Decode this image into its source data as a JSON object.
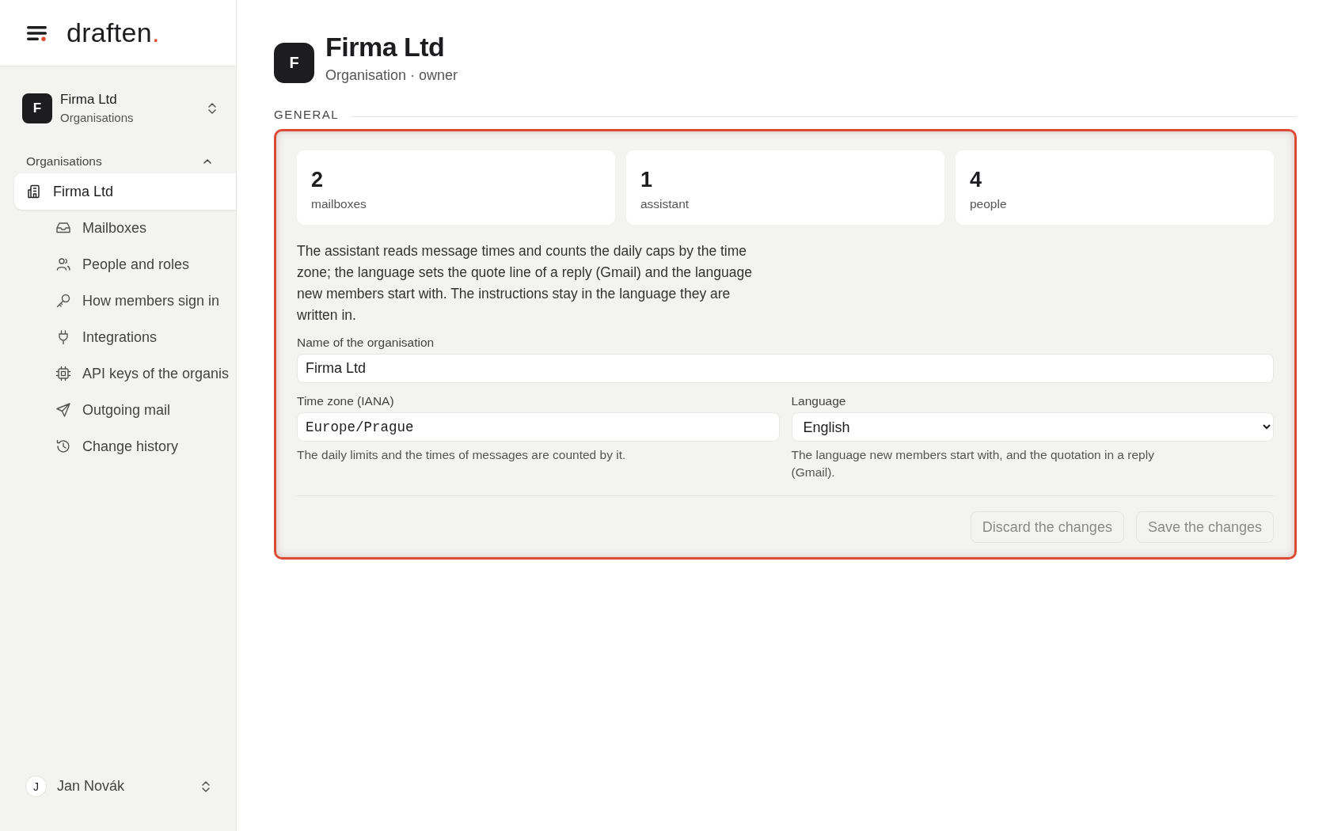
{
  "brand": {
    "name": "draften",
    "dot": "."
  },
  "org_switcher": {
    "initial": "F",
    "name": "Firma Ltd",
    "subtitle": "Organisations"
  },
  "nav": {
    "heading": "Organisations",
    "expanded": true,
    "items": [
      {
        "label": "Firma Ltd",
        "selected": true,
        "children": [
          {
            "label": "Mailboxes",
            "selected": false
          },
          {
            "label": "People and roles",
            "selected": false
          },
          {
            "label": "How members sign in",
            "selected": false
          },
          {
            "label": "Integrations",
            "selected": false
          },
          {
            "label": "API keys of the organis",
            "selected": false
          },
          {
            "label": "Outgoing mail",
            "selected": false
          },
          {
            "label": "Change history",
            "selected": false
          }
        ]
      }
    ]
  },
  "user": {
    "initial": "J",
    "name": "Jan Novák"
  },
  "header": {
    "initial": "F",
    "title": "Firma Ltd",
    "subtitle": "Organisation · owner"
  },
  "section": {
    "title": "GENERAL",
    "highlighted": true,
    "stats": [
      {
        "value": "2",
        "label": "mailboxes"
      },
      {
        "value": "1",
        "label": "assistant"
      },
      {
        "value": "4",
        "label": "people"
      }
    ],
    "description": "The assistant reads message times and counts the daily caps by the time zone; the language sets the quote line of a reply (Gmail) and the language new members start with. The instructions stay in the language they are written in.",
    "name_field": {
      "label": "Name of the organisation",
      "value": "Firma Ltd"
    },
    "timezone_field": {
      "label": "Time zone (IANA)",
      "value": "Europe/Prague",
      "hint": "The daily limits and the times of messages are counted by it."
    },
    "language_field": {
      "label": "Language",
      "value": "English",
      "hint": "The language new members start with, and the quotation in a reply (Gmail)."
    },
    "buttons": [
      {
        "label": "Discard the changes",
        "disabled": true
      },
      {
        "label": "Save the changes",
        "disabled": true
      }
    ]
  }
}
